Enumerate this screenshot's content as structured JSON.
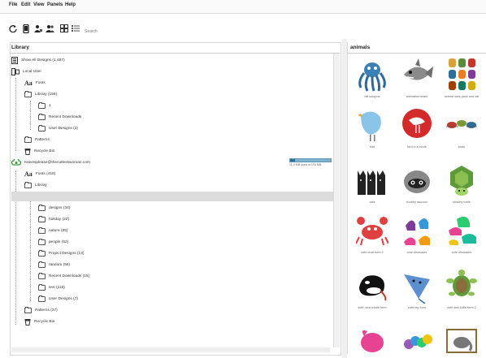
{
  "menu": [
    "File",
    "Edit",
    "View",
    "Panels",
    "Help"
  ],
  "toolbar": {
    "search_label": "Search",
    "icons": [
      "sync-icon",
      "device-icon",
      "user-icon",
      "users-icon",
      "grid-view-icon",
      "list-view-icon"
    ]
  },
  "library": {
    "title": "Library",
    "show_all": "Show All Designs (1,487)",
    "local_user": "Local User",
    "local": {
      "fonts": "Fonts",
      "library": "Library (158)",
      "children": [
        "1",
        "Recent Downloads",
        "User Designs (3)"
      ],
      "patterns": "Patterns",
      "recycle": "Recycle Bin"
    },
    "account": {
      "email": "Knivesplease@thecutlesswoman.com",
      "storage_text": "11.3 MB used of 100 MB",
      "storage_fraction": 0.11,
      "fonts": "Fonts (418)",
      "library": "Library",
      "folders": [
        "designs (34)",
        "holiday (22)",
        "nature (85)",
        "people (52)",
        "Project Designs (14)",
        "random (58)",
        "Recent Downloads (15)",
        "text (118)",
        "User Designs (7)"
      ],
      "patterns": "Patterns (37)",
      "recycle": "Recycle Bin"
    }
  },
  "animals": {
    "title": "animals",
    "items": [
      "bill octopus",
      "animation shark",
      "animal owls pack and cat",
      "bird",
      "bird in a circle",
      "birds",
      "cats",
      "chubby raccoon",
      "chubby turtle",
      "cute crab form 2",
      "cute dinosaurs",
      "cute dinosaurs",
      "cute orca whale form",
      "cute ray form",
      "cute sea turtle form 2",
      "",
      "",
      ""
    ]
  },
  "colors": {
    "octopus": "#3a7fb5",
    "shark": "#8a8a8a",
    "bird": "#8ac4e8",
    "circle": "#d42a2a",
    "crab": "#e04040",
    "ray": "#5a8fd0",
    "turtle": "#5f9a3a",
    "cats": "#222222",
    "storage_bar": "#7fb2cc"
  }
}
